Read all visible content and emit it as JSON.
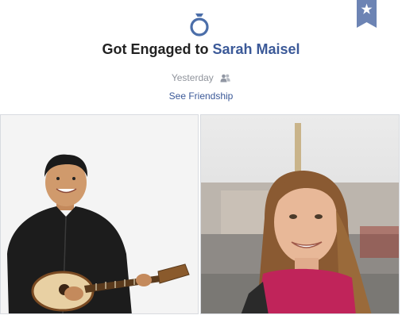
{
  "event": {
    "icon": "engagement-ring-icon",
    "headline_prefix": "Got Engaged to ",
    "partner_name": "Sarah Maisel",
    "timestamp": "Yesterday",
    "audience_icon": "friends-icon",
    "see_friendship_label": "See Friendship"
  },
  "bookmark_icon": "star-bookmark-icon",
  "photos": [
    {
      "subject": "man-with-ukulele-photo"
    },
    {
      "subject": "woman-portrait-photo"
    }
  ],
  "colors": {
    "link": "#3b5998",
    "headline_text": "#222222",
    "meta_text": "#90949c",
    "bookmark": "#6d84b4"
  }
}
